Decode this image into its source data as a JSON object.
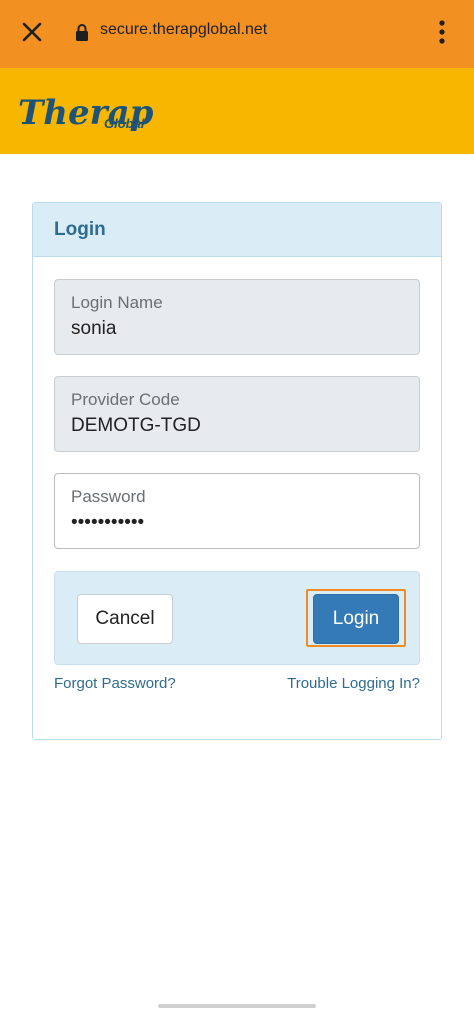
{
  "browser": {
    "url": "secure.therapglobal.net"
  },
  "brand": {
    "logo_text": "Therap",
    "logo_suffix": "Global",
    "colors": {
      "urlbar": "#f29022",
      "banner": "#f7b600",
      "accent": "#337ab7"
    }
  },
  "login": {
    "title": "Login",
    "fields": [
      {
        "label": "Login Name",
        "value": "sonia"
      },
      {
        "label": "Provider Code",
        "value": "DEMOTG-TGD"
      },
      {
        "label": "Password",
        "value": "•••••••••••"
      }
    ],
    "cancel_label": "Cancel",
    "login_label": "Login",
    "forgot_label": "Forgot Password?",
    "trouble_label": "Trouble Logging In?"
  },
  "icons": [
    "close-icon",
    "lock-icon",
    "more-vert-icon"
  ]
}
